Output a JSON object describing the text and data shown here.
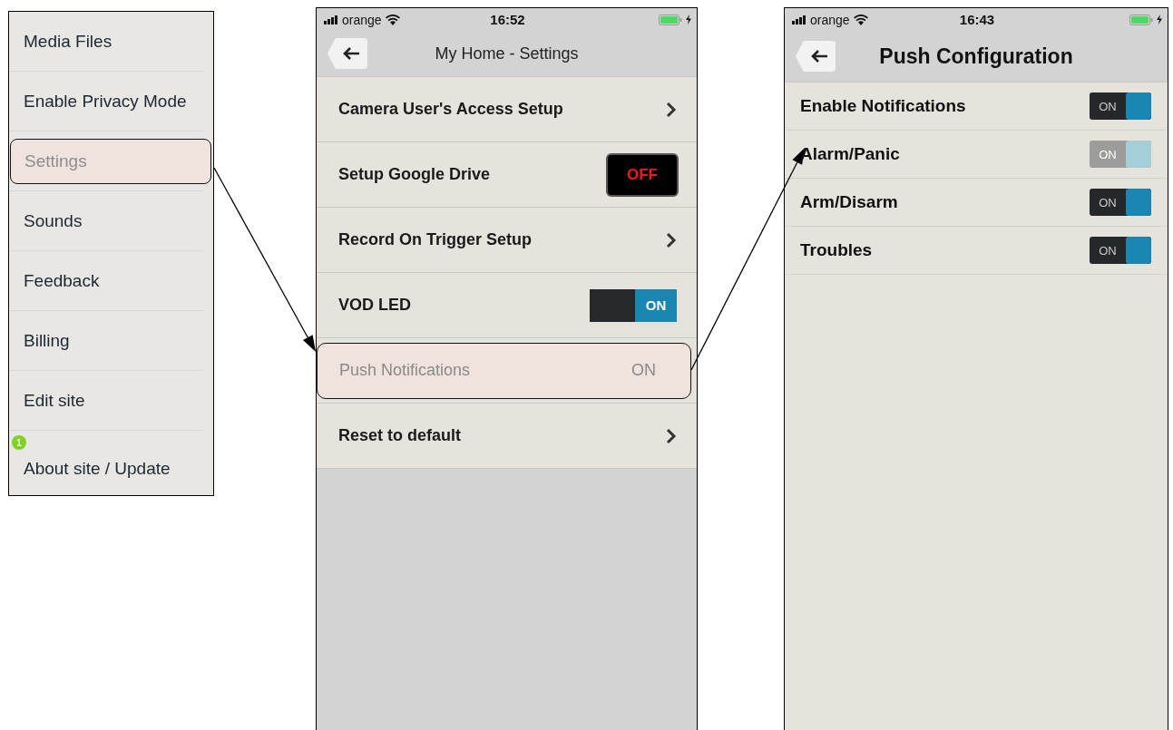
{
  "menu": {
    "items": [
      {
        "label": "Media Files",
        "selected": false
      },
      {
        "label": "Enable Privacy Mode",
        "selected": false
      },
      {
        "label": "Settings",
        "selected": true
      },
      {
        "label": "Sounds",
        "selected": false
      },
      {
        "label": "Feedback",
        "selected": false
      },
      {
        "label": "Billing",
        "selected": false
      },
      {
        "label": "Edit site",
        "selected": false
      },
      {
        "label": "About site / Update",
        "selected": false,
        "badge": "1"
      }
    ]
  },
  "settings_screen": {
    "status_bar": {
      "carrier": "orange",
      "time": "16:52"
    },
    "title": "My Home - Settings",
    "rows": [
      {
        "kind": "chevron",
        "label": "Camera User's Access Setup",
        "selected": false
      },
      {
        "kind": "box_toggle",
        "label": "Setup Google Drive",
        "value": "OFF",
        "selected": false
      },
      {
        "kind": "chevron",
        "label": "Record On Trigger Setup",
        "selected": false
      },
      {
        "kind": "switch",
        "label": "VOD LED",
        "value": "ON",
        "on": true,
        "selected": false
      },
      {
        "kind": "value",
        "label": "Push Notifications",
        "value": "ON",
        "selected": true
      },
      {
        "kind": "chevron",
        "label": "Reset to default",
        "selected": false
      }
    ]
  },
  "push_screen": {
    "status_bar": {
      "carrier": "orange",
      "time": "16:43"
    },
    "title": "Push Configuration",
    "rows": [
      {
        "label": "Enable Notifications",
        "toggle": "ON",
        "on": true,
        "disabled": false
      },
      {
        "label": "Alarm/Panic",
        "toggle": "ON",
        "on": true,
        "disabled": true
      },
      {
        "label": "Arm/Disarm",
        "toggle": "ON",
        "on": true,
        "disabled": false
      },
      {
        "label": "Troubles",
        "toggle": "ON",
        "on": true,
        "disabled": false
      }
    ]
  }
}
